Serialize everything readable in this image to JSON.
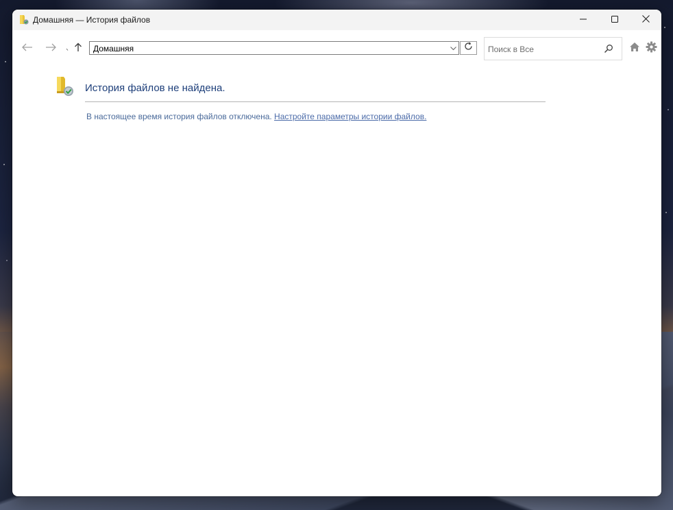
{
  "window": {
    "title": "Домашняя — История файлов"
  },
  "toolbar": {
    "address_value": "Домашняя",
    "search_placeholder": "Поиск в Все"
  },
  "content": {
    "heading": "История файлов не найдена.",
    "message": "В настоящее время история файлов отключена.",
    "link_text": "Настройте параметры истории файлов."
  },
  "colors": {
    "heading": "#1e3f7a",
    "message": "#4a6a9a",
    "link": "#4a6aa8",
    "titlebar": "#f3f3f3"
  },
  "icons": {
    "app": "file-history-folder-icon",
    "back": "arrow-left-icon",
    "forward": "arrow-right-icon",
    "recent": "chevron-down-small-icon",
    "up": "arrow-up-icon",
    "dropdown": "chevron-down-icon",
    "refresh": "refresh-icon",
    "search": "search-icon",
    "home": "home-icon",
    "settings": "gear-icon",
    "minimize": "minimize-icon",
    "maximize": "maximize-icon",
    "close": "close-icon"
  }
}
